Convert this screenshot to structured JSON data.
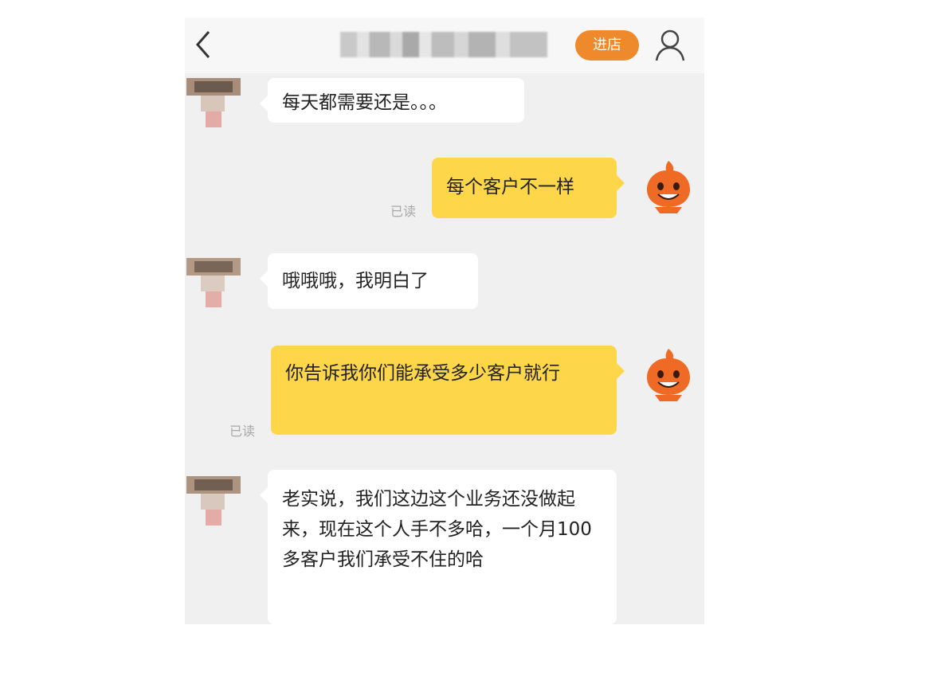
{
  "header": {
    "back_icon": "chevron-left-icon",
    "enter_store_label": "进店",
    "profile_icon": "user-icon",
    "accent_color": "#ee8a2c"
  },
  "messages": [
    {
      "side": "in",
      "text": "每天都需要还是。。。"
    },
    {
      "side": "out",
      "text": "每个客户不一样",
      "status": "已读"
    },
    {
      "side": "in",
      "text": "哦哦哦，我明白了"
    },
    {
      "side": "out",
      "text": "你告诉我你们能承受多少客户就行",
      "status": "已读"
    },
    {
      "side": "in",
      "text": "老实说，我们这边这个业务还没做起来，现在这个人手不多哈，一个月100多客户我们承受不住的哈"
    }
  ],
  "colors": {
    "incoming_bubble": "#ffffff",
    "outgoing_bubble": "#fdd64a",
    "chat_background": "#f0f0f1"
  }
}
